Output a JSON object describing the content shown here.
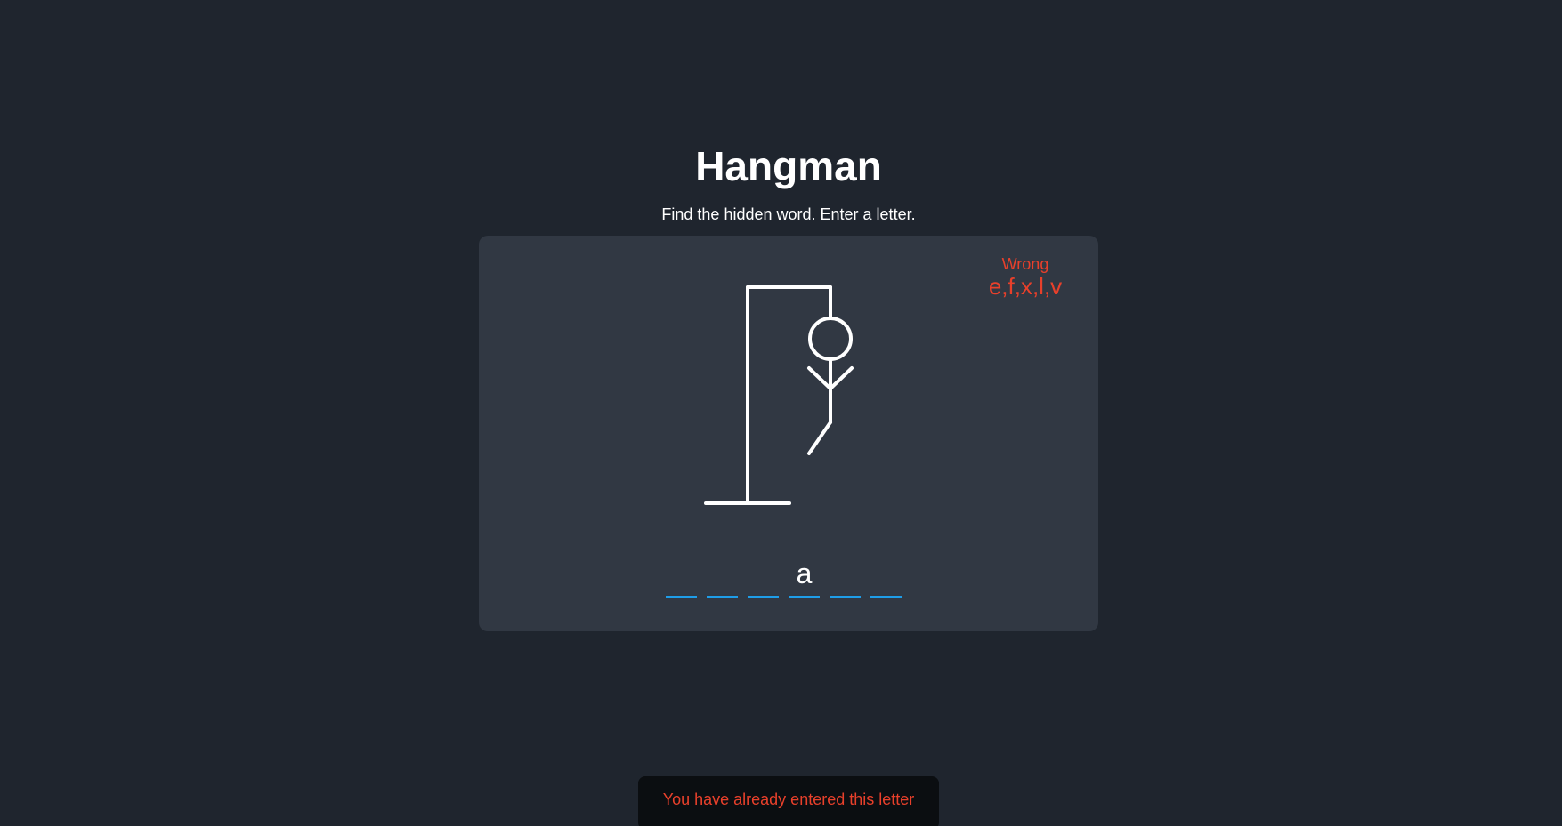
{
  "header": {
    "title": "Hangman",
    "subtitle": "Find the hidden word. Enter a letter."
  },
  "wrong": {
    "label": "Wrong",
    "letters": "e,f,x,l,v"
  },
  "word": {
    "slots": [
      "",
      "",
      "",
      "a",
      "",
      ""
    ]
  },
  "notification": {
    "message": "You have already entered this letter"
  },
  "game_state": {
    "wrong_guess_count": 5,
    "figure_parts_shown": [
      "head",
      "body",
      "left-arm",
      "right-arm",
      "left-leg"
    ]
  },
  "colors": {
    "background": "#1f252e",
    "card": "#313843",
    "wrong_text": "#e8402b",
    "slot_underline": "#1e9de8",
    "toast_background": "#0b0e11"
  }
}
